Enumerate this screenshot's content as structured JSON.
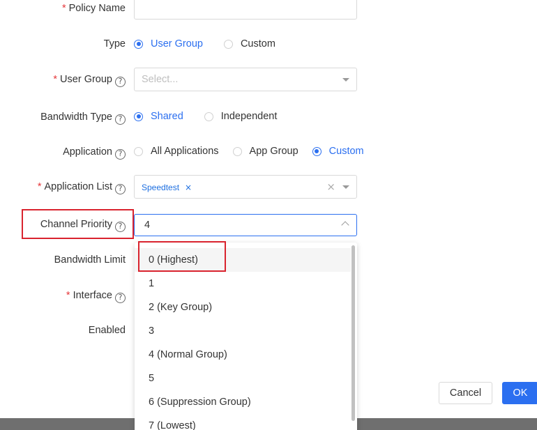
{
  "form": {
    "policy_name": {
      "label": "Policy Name",
      "required": "*",
      "value": ""
    },
    "type": {
      "label": "Type",
      "options": [
        {
          "label": "User Group",
          "checked": true
        },
        {
          "label": "Custom",
          "checked": false
        }
      ]
    },
    "user_group": {
      "label": "User Group",
      "required": "*",
      "placeholder": "Select..."
    },
    "bandwidth_type": {
      "label": "Bandwidth Type",
      "options": [
        {
          "label": "Shared",
          "checked": true
        },
        {
          "label": "Independent",
          "checked": false
        }
      ]
    },
    "application": {
      "label": "Application",
      "options": [
        {
          "label": "All Applications",
          "checked": false
        },
        {
          "label": "App Group",
          "checked": false
        },
        {
          "label": "Custom",
          "checked": true
        }
      ]
    },
    "application_list": {
      "label": "Application List",
      "required": "*",
      "tag": "Speedtest",
      "tag_remove": "×",
      "clear": "×"
    },
    "channel_priority": {
      "label": "Channel Priority",
      "value": "4"
    },
    "bandwidth_limit": {
      "label": "Bandwidth Limit"
    },
    "interface": {
      "label": "Interface",
      "required": "*"
    },
    "enabled": {
      "label": "Enabled"
    },
    "help_glyph": "?"
  },
  "dropdown": {
    "options": [
      "0 (Highest)",
      "1",
      "2 (Key Group)",
      "3",
      "4 (Normal Group)",
      "5",
      "6 (Suppression Group)",
      "7 (Lowest)"
    ],
    "hovered_index": 0
  },
  "buttons": {
    "cancel": "Cancel",
    "ok": "OK"
  },
  "colors": {
    "accent": "#2b6ff0",
    "highlight": "#d9232e",
    "required": "#e5383b"
  }
}
